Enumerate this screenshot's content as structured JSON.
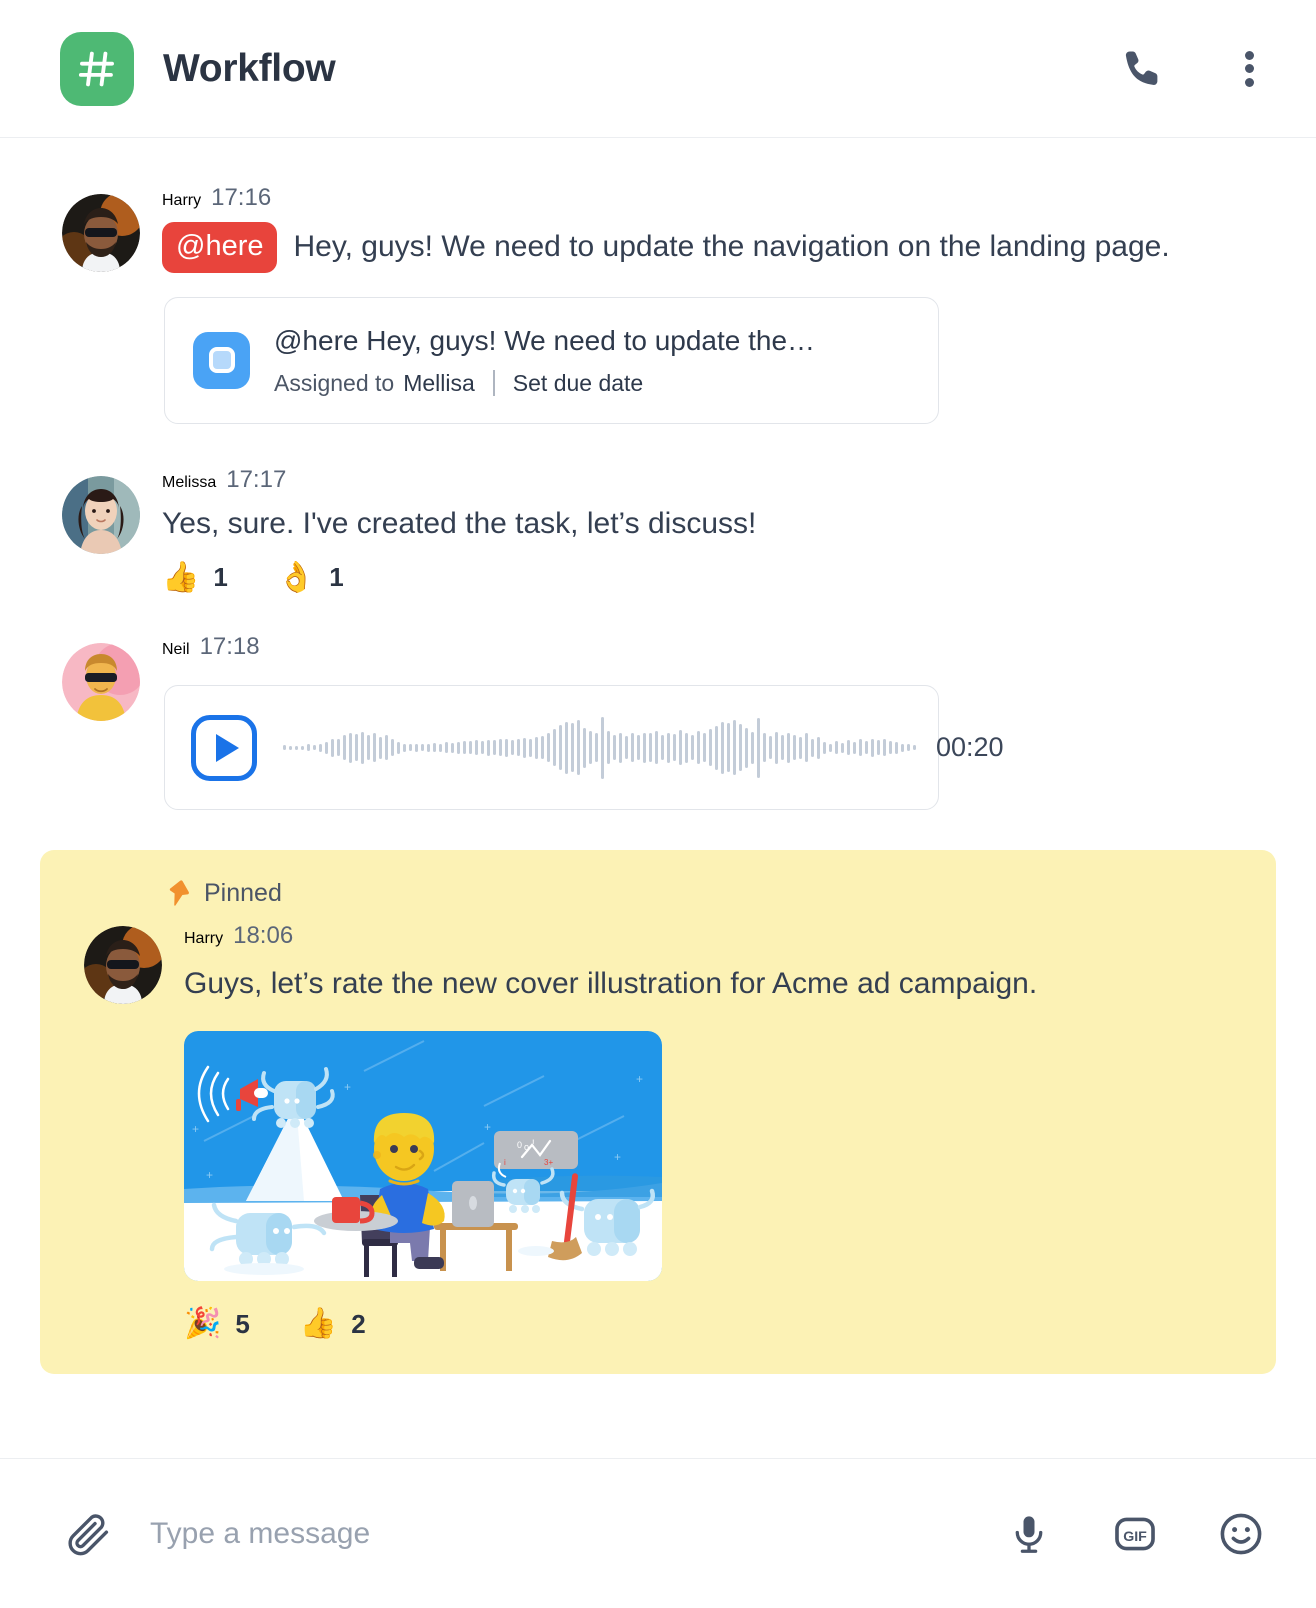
{
  "header": {
    "channel_icon": "hash-icon",
    "channel_icon_color": "#4EB974",
    "title": "Workflow",
    "call_icon": "phone-icon",
    "menu_icon": "kebab-menu-icon"
  },
  "messages": [
    {
      "id": "msg-harry-1",
      "author": "Harry",
      "time": "17:16",
      "avatar": "harry-avatar",
      "mention": "@here",
      "mention_color": "#E8443C",
      "text": "Hey, guys! We need to update the navigation on the landing page.",
      "task_card": {
        "icon": "task-icon",
        "icon_color": "#4AA3F5",
        "title": "@here Hey, guys! We need to update the…",
        "assigned_label": "Assigned to",
        "assignee": "Mellisa",
        "due_label": "Set due date"
      }
    },
    {
      "id": "msg-melissa-1",
      "author": "Melissa",
      "time": "17:17",
      "avatar": "melissa-avatar",
      "text": "Yes, sure. I've created the task, let’s discuss!",
      "reactions": [
        {
          "emoji": "👍",
          "name": "thumbs-up",
          "count": "1"
        },
        {
          "emoji": "👌",
          "name": "ok-hand",
          "count": "1"
        }
      ]
    },
    {
      "id": "msg-neil-1",
      "author": "Neil",
      "time": "17:18",
      "avatar": "neil-avatar",
      "voice": {
        "play_icon": "play-icon",
        "play_color": "#1A73E8",
        "duration": "00:20",
        "waveform": [
          6,
          4,
          5,
          4,
          8,
          6,
          10,
          14,
          22,
          20,
          30,
          36,
          32,
          38,
          30,
          34,
          26,
          30,
          20,
          14,
          10,
          8,
          9,
          8,
          10,
          11,
          10,
          13,
          12,
          14,
          16,
          15,
          18,
          16,
          19,
          18,
          20,
          22,
          18,
          20,
          24,
          22,
          26,
          28,
          34,
          44,
          54,
          62,
          58,
          66,
          48,
          40,
          34,
          74,
          40,
          30,
          36,
          28,
          34,
          30,
          36,
          34,
          40,
          30,
          36,
          32,
          42,
          36,
          30,
          40,
          34,
          44,
          52,
          62,
          58,
          66,
          56,
          48,
          38,
          72,
          34,
          28,
          38,
          30,
          36,
          30,
          26,
          34,
          22,
          26,
          14,
          10,
          16,
          12,
          18,
          14,
          20,
          16,
          22,
          18,
          20,
          16,
          14,
          10,
          8,
          6
        ]
      }
    }
  ],
  "pinned": {
    "label": "Pinned",
    "pin_icon": "pin-icon",
    "background": "#FCF2B5",
    "author": "Harry",
    "time": "18:06",
    "avatar": "harry-avatar",
    "text": "Guys, let’s rate the new cover illustration for Acme ad campaign.",
    "image_alt": "cover-illustration",
    "reactions": [
      {
        "emoji": "🎉",
        "name": "party-popper",
        "count": "5"
      },
      {
        "emoji": "👍",
        "name": "thumbs-up",
        "count": "2"
      }
    ]
  },
  "composer": {
    "attach_icon": "paperclip-icon",
    "placeholder": "Type a message",
    "value": "",
    "mic_icon": "microphone-icon",
    "gif_icon": "gif-icon",
    "gif_label": "GIF",
    "emoji_icon": "smiley-icon"
  }
}
